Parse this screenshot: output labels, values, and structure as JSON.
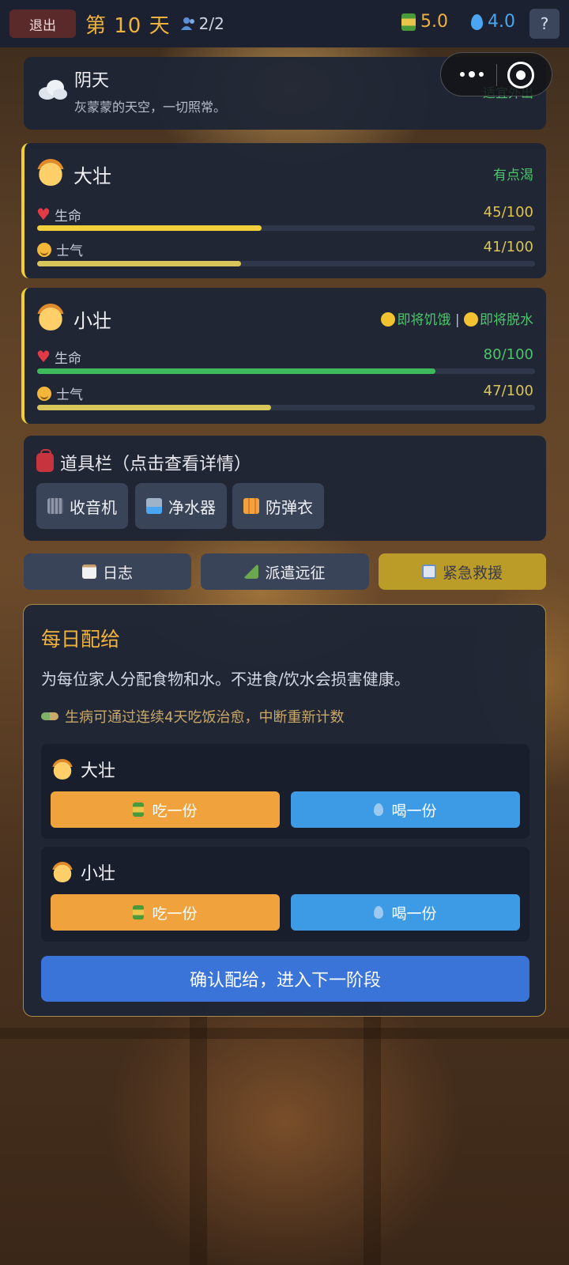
{
  "top_bar": {
    "exit_label": "退出",
    "day_label": "第 10 天",
    "people_count": "2/2",
    "food_value": "5.0",
    "water_value": "4.0",
    "help_label": "?"
  },
  "weather": {
    "title": "阴天",
    "description": "灰蒙蒙的天空，一切照常。",
    "tag": "适宜外出"
  },
  "members": [
    {
      "name": "大壮",
      "status": "有点渴",
      "health_label": "生命",
      "health_value": "45/100",
      "health_fraction": 0.45,
      "morale_label": "士气",
      "morale_value": "41/100",
      "morale_fraction": 0.41
    },
    {
      "name": "小壮",
      "status_1": "即将饥饿",
      "status_sep": "|",
      "status_2": "即将脱水",
      "health_label": "生命",
      "health_value": "80/100",
      "health_fraction": 0.8,
      "morale_label": "士气",
      "morale_value": "47/100",
      "morale_fraction": 0.47
    }
  ],
  "inventory": {
    "title": "道具栏（点击查看详情）",
    "items": [
      "收音机",
      "净水器",
      "防弹衣"
    ]
  },
  "tabs": [
    "日志",
    "派遣远征",
    "紧急救援"
  ],
  "ration": {
    "title": "每日配给",
    "description": "为每位家人分配食物和水。不进食/饮水会损害健康。",
    "tip": "生病可通过连续4天吃饭治愈，中断重新计数",
    "eat_label": "吃一份",
    "drink_label": "喝一份",
    "confirm_label": "确认配给，进入下一阶段"
  },
  "colors": {
    "accent_gold": "#f0b23e",
    "health_yellow": "#f0cf3a",
    "health_green": "#3dbb5c",
    "morale": "#d9c65a",
    "eat_button": "#f0a33c",
    "drink_button": "#3d9be6",
    "confirm_button": "#3a74d8"
  }
}
